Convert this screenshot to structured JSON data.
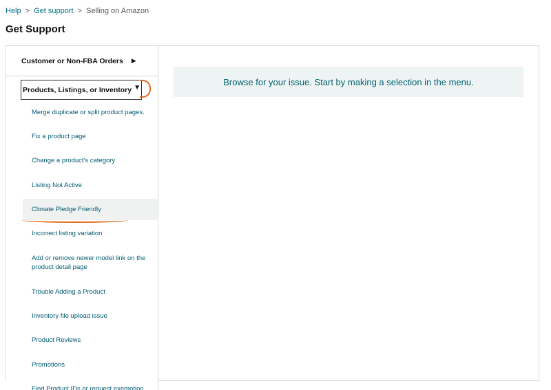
{
  "breadcrumb": {
    "items": [
      "Help",
      "Get support"
    ],
    "current": "Selling on Amazon"
  },
  "page_title": "Get Support",
  "sidebar": {
    "categories": [
      {
        "label": "Customer or Non-FBA Orders",
        "state": "collapsed"
      },
      {
        "label": "Products, Listings, or Inventory",
        "state": "expanded"
      }
    ],
    "items": [
      {
        "label": "Merge duplicate or split product pages."
      },
      {
        "label": "Fix a product page"
      },
      {
        "label": "Change a product's category"
      },
      {
        "label": "Listing Not Active"
      },
      {
        "label": "Climate Pledge Friendly"
      },
      {
        "label": "Incorrect listing variation"
      },
      {
        "label": "Add or remove newer model link on the product detail page"
      },
      {
        "label": "Trouble Adding a Product"
      },
      {
        "label": "Inventory file upload issue"
      },
      {
        "label": "Product Reviews"
      },
      {
        "label": "Promotions"
      },
      {
        "label": "Find Product IDs or request exemption"
      }
    ]
  },
  "main": {
    "prompt": "Browse for your issue. Start by making a selection in the menu."
  },
  "colors": {
    "link": "#007185",
    "border": "#d5d9d9",
    "info_bg": "#eef3f4",
    "annotation": "#e06a1e"
  },
  "icons": {
    "breadcrumb_separator": "chevron-right-icon",
    "collapsed_indicator": "triangle-right-icon",
    "expanded_indicator": "triangle-down-icon"
  }
}
